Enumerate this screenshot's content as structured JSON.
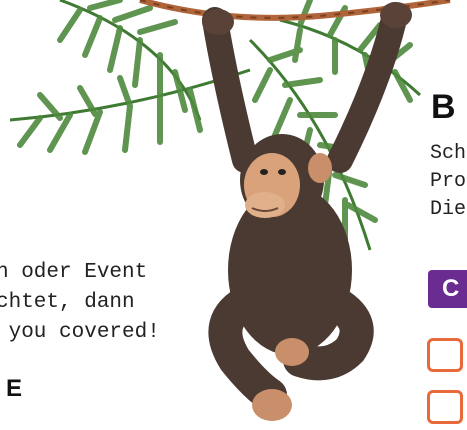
{
  "left_text": {
    "lines": [
      "n oder Event",
      "chtet, dann",
      " you covered!"
    ],
    "heading": "E"
  },
  "right_column": {
    "heading": "B",
    "lines": [
      "Sch",
      "Pro",
      "Die"
    ],
    "badge_label": "C"
  },
  "icons": {
    "illustration": "monkey-hanging-from-vine-icon",
    "leaves": "palm-leaves-icon"
  },
  "colors": {
    "badge": "#6b2c91",
    "checkbox_border": "#e86a3a",
    "vine": "#b0643a",
    "leaf": "#4e8a3e",
    "monkey_fur": "#4a3a32",
    "monkey_skin": "#d9a27a"
  }
}
